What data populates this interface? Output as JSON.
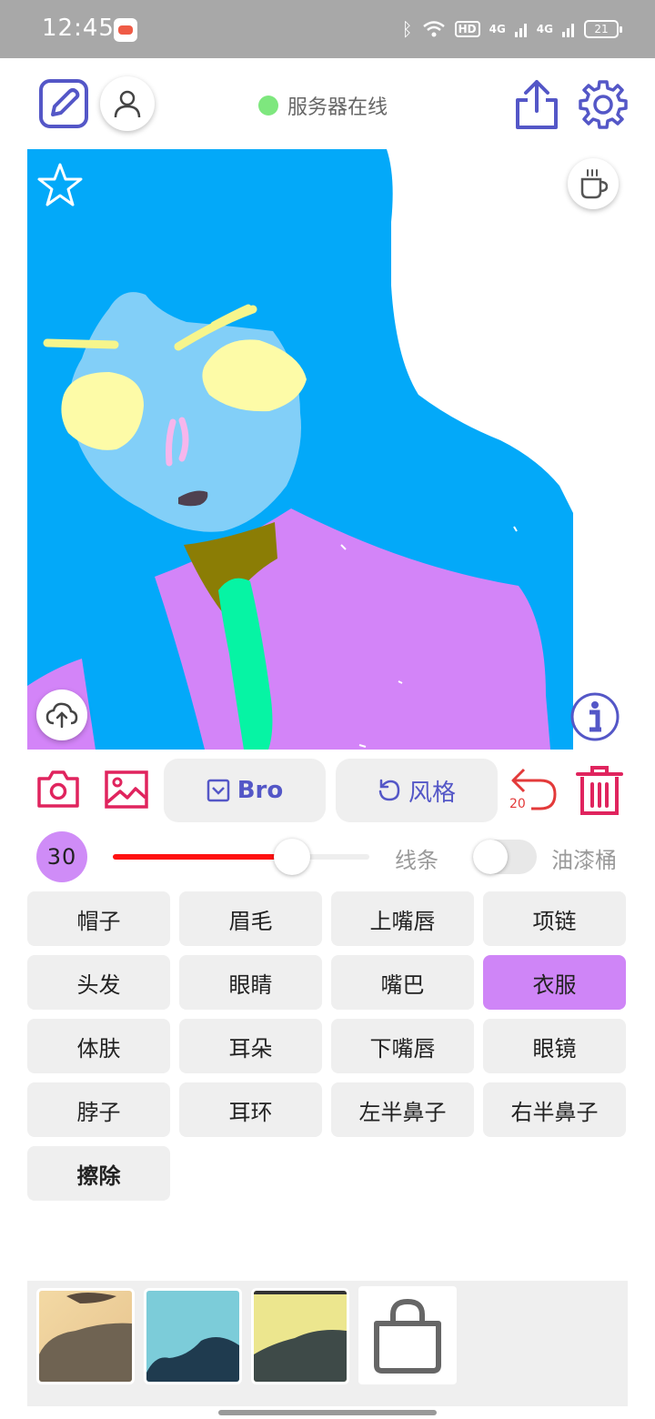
{
  "status_bar": {
    "time": "12:45",
    "hd_badge": "HD",
    "signal_1": "4G",
    "signal_2": "4G",
    "battery": "21"
  },
  "header": {
    "server_status": "服务器在线",
    "server_dot_color": "#7ee77e",
    "edit_icon": "edit-square-icon",
    "avatar_icon": "user-icon",
    "share_icon": "share-icon",
    "settings_icon": "gear-icon"
  },
  "toolbar": {
    "camera_icon": "camera-icon",
    "image_icon": "image-icon",
    "bro_label": "Bro",
    "style_label": "风格",
    "undo_count": "20",
    "accent_color": "#5457c7",
    "danger_color": "#e0245e"
  },
  "brush": {
    "size": "30",
    "slider_level": 0.7,
    "line_label": "线条",
    "bucket_label": "油漆桶",
    "bucket_enabled": false
  },
  "parts": [
    {
      "label": "帽子"
    },
    {
      "label": "眉毛"
    },
    {
      "label": "上嘴唇"
    },
    {
      "label": "项链"
    },
    {
      "label": "头发"
    },
    {
      "label": "眼睛"
    },
    {
      "label": "嘴巴"
    },
    {
      "label": "衣服",
      "active": true
    },
    {
      "label": "体肤"
    },
    {
      "label": "耳朵"
    },
    {
      "label": "下嘴唇"
    },
    {
      "label": "眼镜"
    },
    {
      "label": "脖子"
    },
    {
      "label": "耳环"
    },
    {
      "label": "左半鼻子"
    },
    {
      "label": "右半鼻子"
    },
    {
      "label": "擦除"
    }
  ],
  "palette": {
    "hair": "#03a9f9",
    "skin": "#82cff8",
    "clothes": "#d384f8",
    "necklace": "#06f4a4",
    "neck": "#8b7d05",
    "eyes": "#fdfba7",
    "eyebrows": "#f6f58c",
    "mouth": "#4f4150",
    "nose": "#f6b6ec"
  }
}
